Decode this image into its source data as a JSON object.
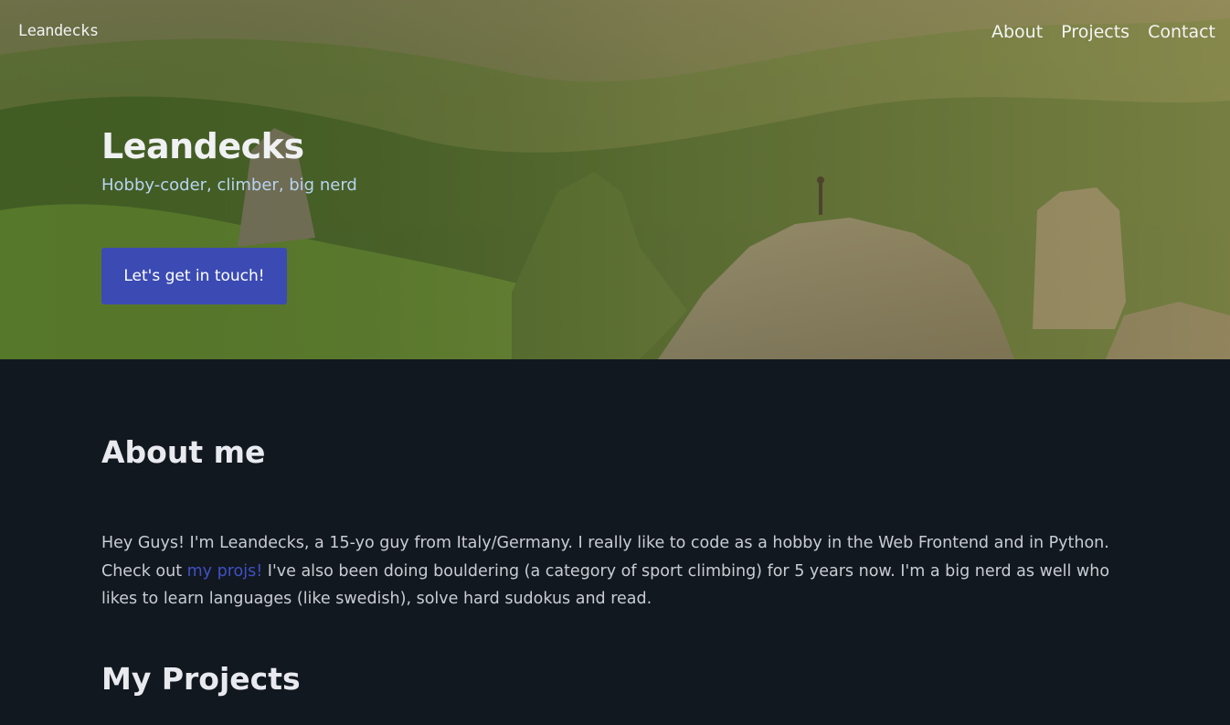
{
  "nav": {
    "logo": "Leandecks",
    "links": [
      {
        "label": "About"
      },
      {
        "label": "Projects"
      },
      {
        "label": "Contact"
      }
    ]
  },
  "hero": {
    "title": "Leandecks",
    "subtitle": "Hobby-coder, climber, big nerd",
    "cta_label": "Let's get in touch!"
  },
  "about": {
    "title": "About me",
    "text_before": "Hey Guys! I'm Leandecks, a 15-yo guy from Italy/Germany. I really like to code as a hobby in the Web Frontend and in Python. Check out ",
    "link_label": "my projs!",
    "text_after": " I've also been doing bouldering (a category of sport climbing) for 5 years now. I'm a big nerd as well who likes to learn languages (like swedish), solve hard sudokus and read."
  },
  "projects": {
    "title": "My Projects"
  },
  "colors": {
    "background": "#121820",
    "button": "#3b4bb3",
    "link": "#3f51c4",
    "subtitle": "#b8d4f0"
  }
}
